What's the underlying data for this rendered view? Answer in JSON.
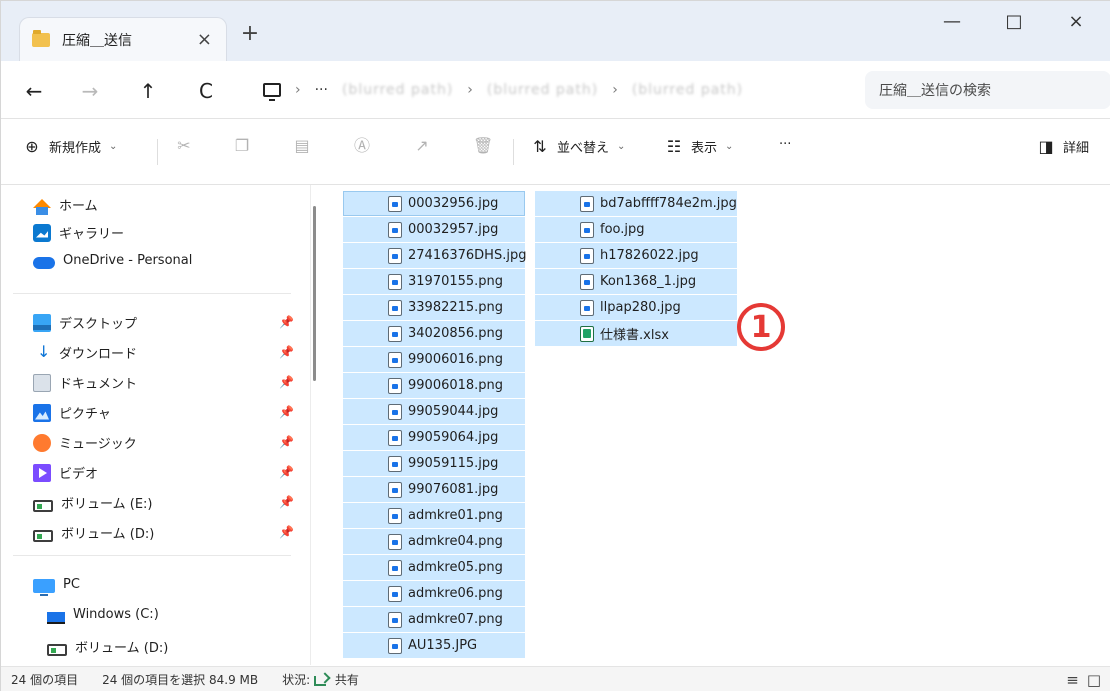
{
  "window": {
    "tab_title": "圧縮＿送信",
    "tab_close": "×",
    "new_tab": "+",
    "minimize": "—",
    "maximize": "□",
    "close": "×"
  },
  "toolbar": {
    "back": "←",
    "forward": "→",
    "up": "↑",
    "refresh": "C"
  },
  "addressbar": {
    "crumb_sep": "›",
    "ellipsis": "···",
    "crumb_1": "(blurred path)",
    "crumb_2": "(blurred path)",
    "crumb_3": "(blurred path)",
    "search_placeholder": "圧縮＿送信の検索"
  },
  "commandbar": {
    "new_label": "新規作成",
    "sort_label": "並べ替え",
    "view_label": "表示",
    "more_label": "···",
    "details_label": "詳細"
  },
  "navpane": {
    "items": [
      {
        "label": "ホーム",
        "icon": "home-icon"
      },
      {
        "label": "ギャラリー",
        "icon": "gallery-icon"
      },
      {
        "label": "OneDrive - Personal",
        "icon": "cloud-icon"
      },
      {
        "label": "デスクトップ",
        "icon": "desktop-icon",
        "pinned": true
      },
      {
        "label": "ダウンロード",
        "icon": "download-icon",
        "pinned": true
      },
      {
        "label": "ドキュメント",
        "icon": "documents-icon",
        "pinned": true
      },
      {
        "label": "ピクチャ",
        "icon": "pictures-icon",
        "pinned": true
      },
      {
        "label": "ミュージック",
        "icon": "music-icon",
        "pinned": true
      },
      {
        "label": "ビデオ",
        "icon": "video-icon",
        "pinned": true
      },
      {
        "label": "ボリューム (E:)",
        "icon": "drive-icon",
        "pinned": true
      },
      {
        "label": "ボリューム (D:)",
        "icon": "drive-icon",
        "pinned": true
      },
      {
        "label": "PC",
        "icon": "pc-icon"
      },
      {
        "label": "Windows (C:)",
        "icon": "windows-drive-icon"
      },
      {
        "label": "ボリューム (D:)",
        "icon": "drive-icon"
      }
    ]
  },
  "files": {
    "column1": [
      "00032956.jpg",
      "00032957.jpg",
      "27416376DHS.jpg",
      "31970155.png",
      "33982215.png",
      "34020856.png",
      "99006016.png",
      "99006018.png",
      "99059044.jpg",
      "99059064.jpg",
      "99059115.jpg",
      "99076081.jpg",
      "admkre01.png",
      "admkre04.png",
      "admkre05.png",
      "admkre06.png",
      "admkre07.png",
      "AU135.JPG"
    ],
    "column2": [
      "bd7abffff784e2m.jpg",
      "foo.jpg",
      "h17826022.jpg",
      "Kon1368_1.jpg",
      "llpap280.jpg",
      "仕様書.xlsx"
    ]
  },
  "annotation": {
    "marker": "1"
  },
  "statusbar": {
    "item_count": "24 個の項目",
    "selection": "24 個の項目を選択 84.9 MB",
    "status_prefix": "状況:",
    "status_value": "共有"
  },
  "colors": {
    "selection": "#cce8ff",
    "accent": "#1a73e8",
    "annotation": "#e53935"
  }
}
